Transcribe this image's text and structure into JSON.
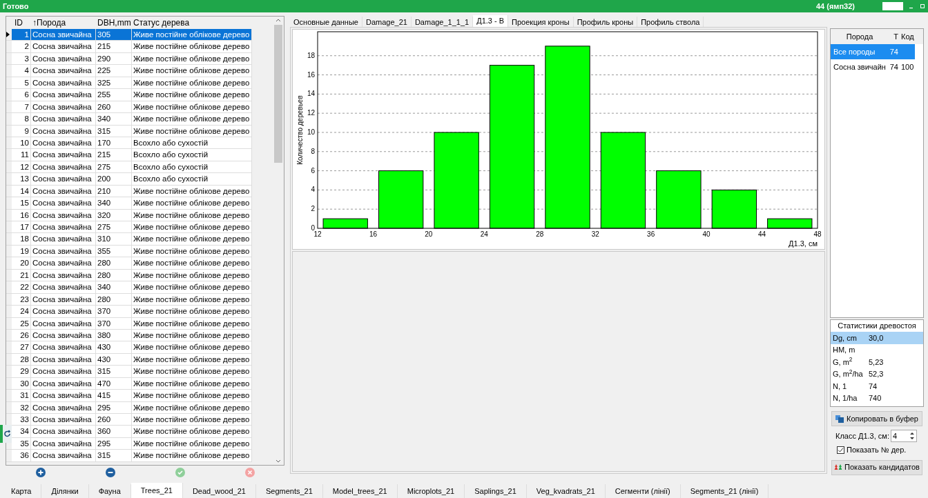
{
  "title_bar": {
    "status": "Готово",
    "plot": "44 (ямп32)"
  },
  "trees_table": {
    "columns": [
      "ID",
      "↑Порода",
      "DBH,mm",
      "Статус дерева"
    ],
    "rows": [
      {
        "id": "1",
        "species": "Сосна звичайна",
        "dbh": "305",
        "status": "Живе постійне облікове дерево",
        "selected": true
      },
      {
        "id": "2",
        "species": "Сосна звичайна",
        "dbh": "215",
        "status": "Живе постійне облікове дерево",
        "selected": false
      },
      {
        "id": "3",
        "species": "Сосна звичайна",
        "dbh": "290",
        "status": "Живе постійне облікове дерево",
        "selected": false
      },
      {
        "id": "4",
        "species": "Сосна звичайна",
        "dbh": "225",
        "status": "Живе постійне облікове дерево",
        "selected": false
      },
      {
        "id": "5",
        "species": "Сосна звичайна",
        "dbh": "325",
        "status": "Живе постійне облікове дерево",
        "selected": false
      },
      {
        "id": "6",
        "species": "Сосна звичайна",
        "dbh": "255",
        "status": "Живе постійне облікове дерево",
        "selected": false
      },
      {
        "id": "7",
        "species": "Сосна звичайна",
        "dbh": "260",
        "status": "Живе постійне облікове дерево",
        "selected": false
      },
      {
        "id": "8",
        "species": "Сосна звичайна",
        "dbh": "340",
        "status": "Живе постійне облікове дерево",
        "selected": false
      },
      {
        "id": "9",
        "species": "Сосна звичайна",
        "dbh": "315",
        "status": "Живе постійне облікове дерево",
        "selected": false
      },
      {
        "id": "10",
        "species": "Сосна звичайна",
        "dbh": "170",
        "status": "Всохло або сухостій",
        "selected": false
      },
      {
        "id": "11",
        "species": "Сосна звичайна",
        "dbh": "215",
        "status": "Всохло або сухостій",
        "selected": false
      },
      {
        "id": "12",
        "species": "Сосна звичайна",
        "dbh": "275",
        "status": "Всохло або сухостій",
        "selected": false
      },
      {
        "id": "13",
        "species": "Сосна звичайна",
        "dbh": "200",
        "status": "Всохло або сухостій",
        "selected": false
      },
      {
        "id": "14",
        "species": "Сосна звичайна",
        "dbh": "210",
        "status": "Живе постійне облікове дерево",
        "selected": false
      },
      {
        "id": "15",
        "species": "Сосна звичайна",
        "dbh": "340",
        "status": "Живе постійне облікове дерево",
        "selected": false
      },
      {
        "id": "16",
        "species": "Сосна звичайна",
        "dbh": "320",
        "status": "Живе постійне облікове дерево",
        "selected": false
      },
      {
        "id": "17",
        "species": "Сосна звичайна",
        "dbh": "275",
        "status": "Живе постійне облікове дерево",
        "selected": false
      },
      {
        "id": "18",
        "species": "Сосна звичайна",
        "dbh": "310",
        "status": "Живе постійне облікове дерево",
        "selected": false
      },
      {
        "id": "19",
        "species": "Сосна звичайна",
        "dbh": "355",
        "status": "Живе постійне облікове дерево",
        "selected": false
      },
      {
        "id": "20",
        "species": "Сосна звичайна",
        "dbh": "280",
        "status": "Живе постійне облікове дерево",
        "selected": false
      },
      {
        "id": "21",
        "species": "Сосна звичайна",
        "dbh": "280",
        "status": "Живе постійне облікове дерево",
        "selected": false
      },
      {
        "id": "22",
        "species": "Сосна звичайна",
        "dbh": "340",
        "status": "Живе постійне облікове дерево",
        "selected": false
      },
      {
        "id": "23",
        "species": "Сосна звичайна",
        "dbh": "280",
        "status": "Живе постійне облікове дерево",
        "selected": false
      },
      {
        "id": "24",
        "species": "Сосна звичайна",
        "dbh": "370",
        "status": "Живе постійне облікове дерево",
        "selected": false
      },
      {
        "id": "25",
        "species": "Сосна звичайна",
        "dbh": "370",
        "status": "Живе постійне облікове дерево",
        "selected": false
      },
      {
        "id": "26",
        "species": "Сосна звичайна",
        "dbh": "380",
        "status": "Живе постійне облікове дерево",
        "selected": false
      },
      {
        "id": "27",
        "species": "Сосна звичайна",
        "dbh": "430",
        "status": "Живе постійне облікове дерево",
        "selected": false
      },
      {
        "id": "28",
        "species": "Сосна звичайна",
        "dbh": "430",
        "status": "Живе постійне облікове дерево",
        "selected": false
      },
      {
        "id": "29",
        "species": "Сосна звичайна",
        "dbh": "315",
        "status": "Живе постійне облікове дерево",
        "selected": false
      },
      {
        "id": "30",
        "species": "Сосна звичайна",
        "dbh": "470",
        "status": "Живе постійне облікове дерево",
        "selected": false
      },
      {
        "id": "31",
        "species": "Сосна звичайна",
        "dbh": "415",
        "status": "Живе постійне облікове дерево",
        "selected": false
      },
      {
        "id": "32",
        "species": "Сосна звичайна",
        "dbh": "295",
        "status": "Живе постійне облікове дерево",
        "selected": false
      },
      {
        "id": "33",
        "species": "Сосна звичайна",
        "dbh": "260",
        "status": "Живе постійне облікове дерево",
        "selected": false
      },
      {
        "id": "34",
        "species": "Сосна звичайна",
        "dbh": "360",
        "status": "Живе постійне облікове дерево",
        "selected": false
      },
      {
        "id": "35",
        "species": "Сосна звичайна",
        "dbh": "295",
        "status": "Живе постійне облікове дерево",
        "selected": false
      },
      {
        "id": "36",
        "species": "Сосна звичайна",
        "dbh": "315",
        "status": "Живе постійне облікове дерево",
        "selected": false
      }
    ]
  },
  "detail_tabs": [
    {
      "label": "Основные данные",
      "selected": false
    },
    {
      "label": "Damage_21",
      "selected": false
    },
    {
      "label": "Damage_1_1_1",
      "selected": false
    },
    {
      "label": "Д1.3 - В",
      "selected": true
    },
    {
      "label": "Проекция кроны",
      "selected": false
    },
    {
      "label": "Профиль кроны",
      "selected": false
    },
    {
      "label": "Профиль ствола",
      "selected": false
    }
  ],
  "chart_data": {
    "type": "bar",
    "xlabel": "Д1.3, см",
    "ylabel": "Количество деревьев",
    "x": [
      14,
      18,
      22,
      26,
      30,
      34,
      38,
      42,
      46
    ],
    "series": [
      {
        "color": "#00ff00",
        "values": [
          1,
          6,
          10,
          17,
          19,
          10,
          6,
          4,
          1
        ]
      }
    ],
    "grid": true,
    "xlim": [
      12,
      48
    ],
    "ylim": [
      0,
      20.5
    ],
    "xticks": [
      12,
      16,
      20,
      24,
      28,
      32,
      36,
      40,
      44,
      48
    ],
    "yticks": [
      0,
      2,
      4,
      6,
      8,
      10,
      12,
      14,
      16,
      18
    ]
  },
  "species_table": {
    "columns": [
      "Порода",
      "T",
      "Код"
    ],
    "rows": [
      {
        "name": "Все породы",
        "t": "74",
        "selected": true
      },
      {
        "name": "Сосна звичайн",
        "t": "74",
        "code": "100",
        "selected": false
      }
    ]
  },
  "stats": {
    "title": "Статистики древостоя",
    "rows": [
      {
        "label": "Dg, cm",
        "value": "30,0",
        "selected": true
      },
      {
        "label": "HM, m",
        "selected": false
      },
      {
        "label": "G, m$^{2}$",
        "value": "5,23",
        "selected": false
      },
      {
        "label": "G, m$^{2}$/ha",
        "value": "52,3",
        "selected": false
      },
      {
        "label": "N, 1",
        "value": "74",
        "selected": false
      },
      {
        "label": "N, 1/ha",
        "value": "740",
        "selected": false
      }
    ]
  },
  "copy_button": "Копировать в буфер",
  "class_field": {
    "label": "Класс Д1.3, см:",
    "value": "4"
  },
  "show_numbers": {
    "label": "Показать № дер.",
    "checked": true
  },
  "candidates_button": "Показать кандидатов",
  "bottom_tabs": [
    {
      "label": "Карта",
      "selected": false
    },
    {
      "label": "Ділянки",
      "selected": false
    },
    {
      "label": "Фауна",
      "selected": false
    },
    {
      "label": "Trees_21",
      "selected": true
    },
    {
      "label": "Dead_wood_21",
      "selected": false
    },
    {
      "label": "Segments_21",
      "selected": false
    },
    {
      "label": "Model_trees_21",
      "selected": false
    },
    {
      "label": "Microplots_21",
      "selected": false
    },
    {
      "label": "Saplings_21",
      "selected": false
    },
    {
      "label": "Veg_kvadrats_21",
      "selected": false
    },
    {
      "label": "Сегменти (лінії)",
      "selected": false
    },
    {
      "label": "Segments_21 (лінії)",
      "selected": false
    }
  ]
}
